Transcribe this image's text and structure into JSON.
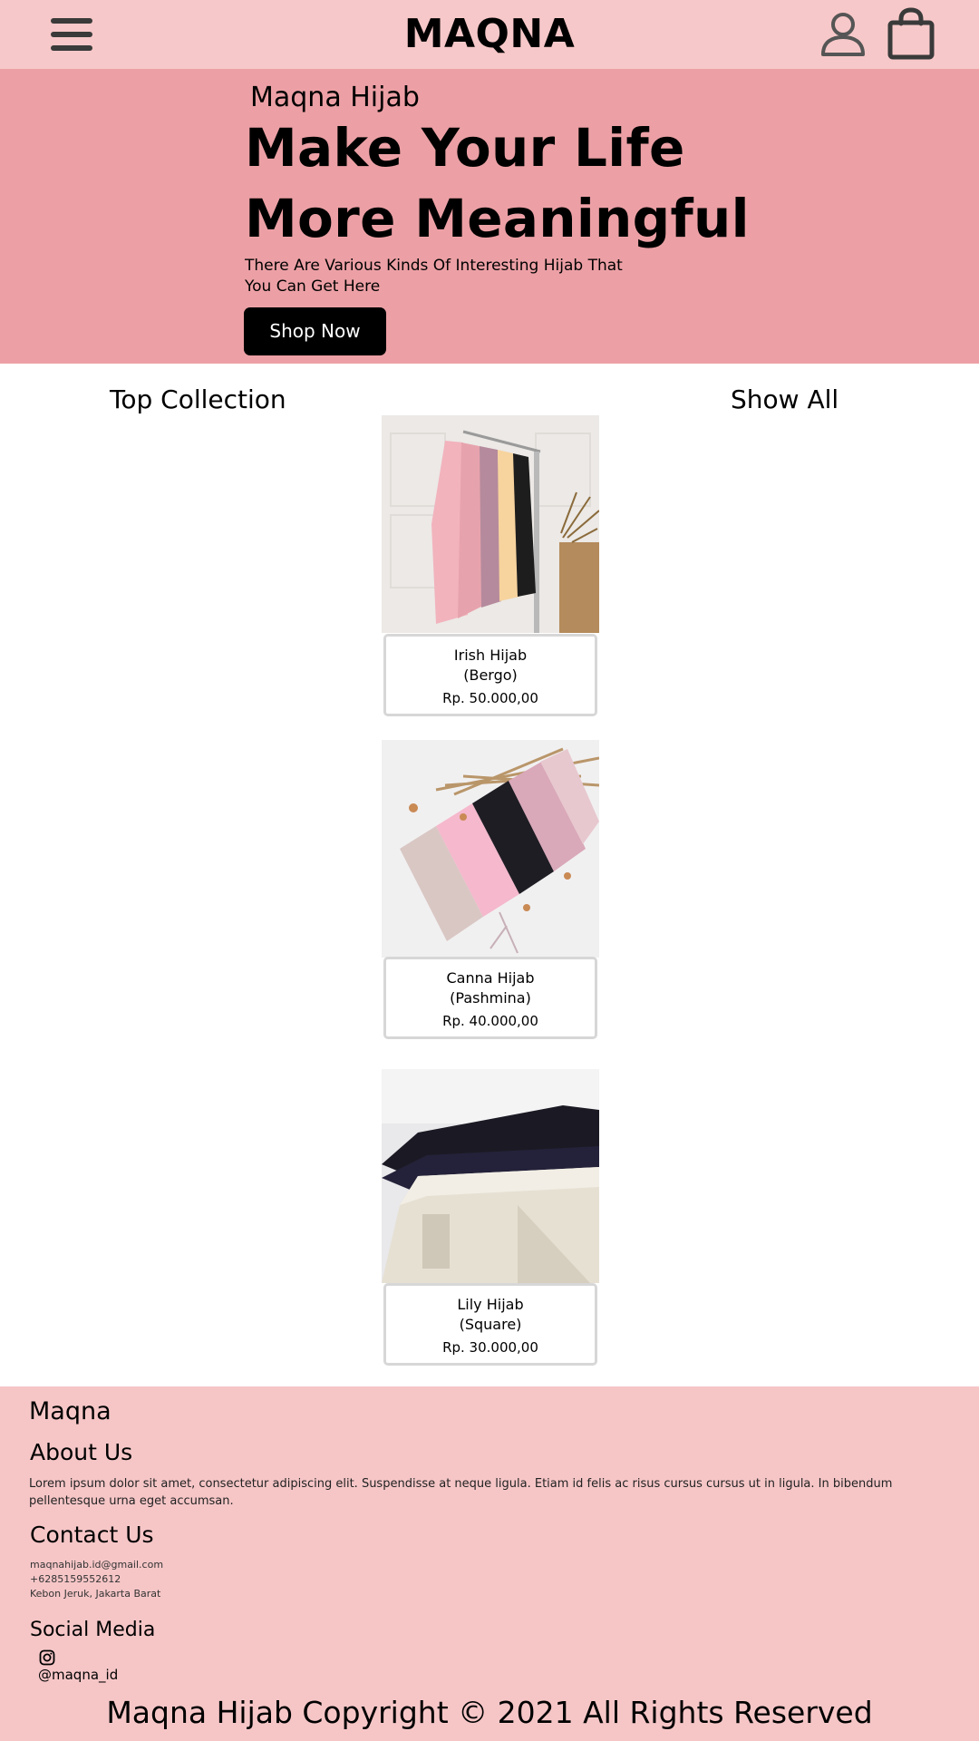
{
  "header": {
    "menu_icon": "hamburger-menu-icon",
    "brand": "MAQNA",
    "user_icon": "user-icon",
    "cart_icon": "shopping-bag-icon"
  },
  "hero": {
    "subtitle": "Maqna Hijab",
    "title_line1": "Make Your Life",
    "title_line2": "More Meaningful",
    "description": "There Are Various Kinds Of Interesting Hijab That You Can Get Here",
    "cta_label": "Shop Now",
    "background_color": "#eca0a5"
  },
  "collection": {
    "title": "Top Collection",
    "show_all_label": "Show All",
    "products": [
      {
        "name_line1": "Irish Hijab",
        "name_line2": "(Bergo)",
        "price": "Rp. 50.000,00"
      },
      {
        "name_line1": "Canna Hijab",
        "name_line2": "(Pashmina)",
        "price": "Rp. 40.000,00"
      },
      {
        "name_line1": "Lily Hijab",
        "name_line2": "(Square)",
        "price": "Rp. 30.000,00"
      }
    ]
  },
  "footer": {
    "brand": "Maqna",
    "about_heading": "About Us",
    "about_text": "Lorem ipsum dolor sit amet, consectetur adipiscing elit. Suspendisse at neque ligula. Etiam id felis ac risus cursus cursus ut in ligula. In bibendum pellentesque urna eget accumsan.",
    "contact_heading": "Contact Us",
    "email": "maqnahijab.id@gmail.com",
    "phone": "+6285159552612",
    "address": "Kebon Jeruk, Jakarta Barat",
    "social_heading": "Social Media",
    "instagram_icon": "instagram-icon",
    "instagram_handle": "@maqna_id",
    "copyright": "Maqna Hijab Copyright © 2021 All Rights Reserved",
    "background_color": "#f6c6c7"
  }
}
